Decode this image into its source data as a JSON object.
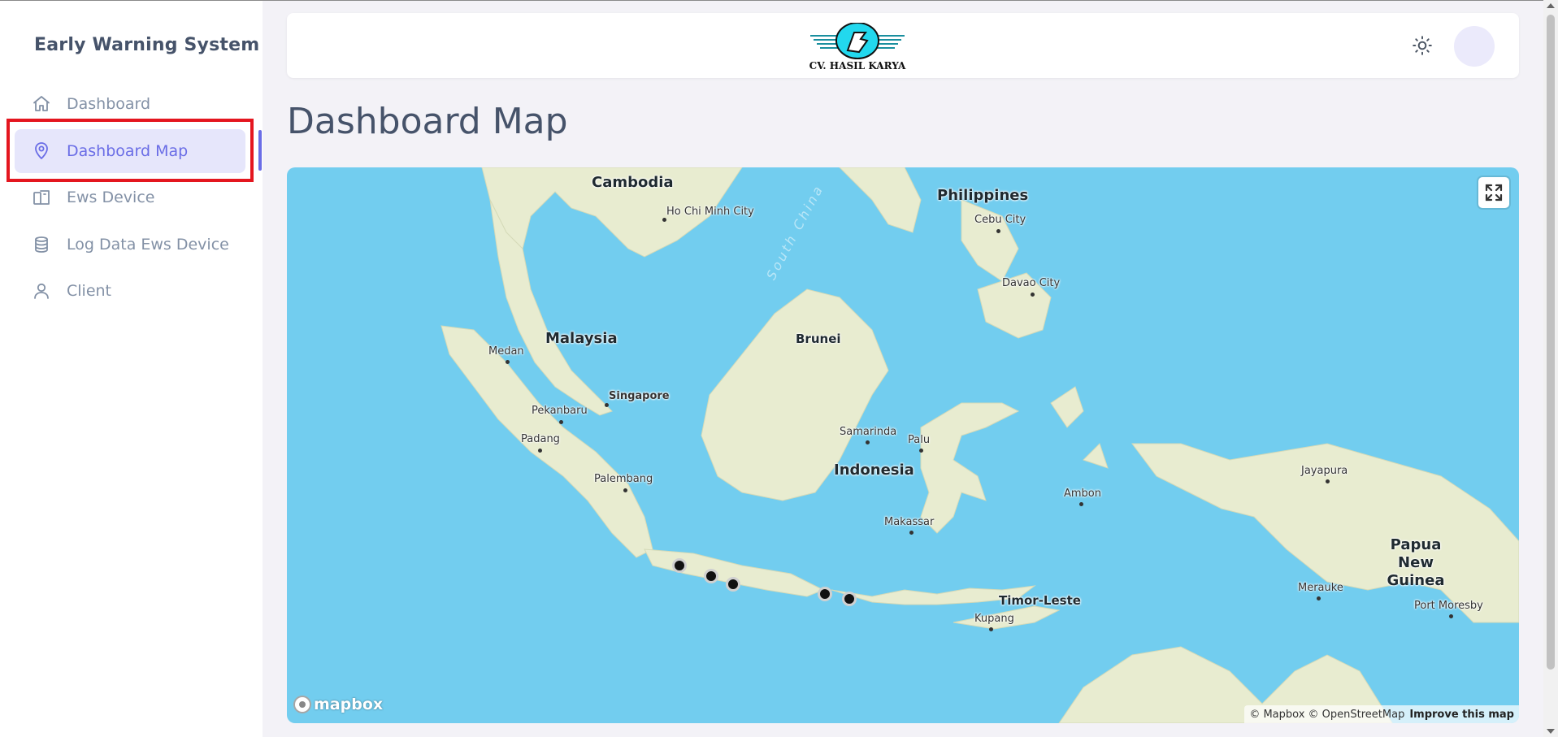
{
  "sidebar": {
    "brand": "Early Warning System",
    "items": [
      {
        "label": "Dashboard",
        "icon": "home-icon"
      },
      {
        "label": "Dashboard Map",
        "icon": "map-pin-icon",
        "active": true
      },
      {
        "label": "Ews Device",
        "icon": "device-icon"
      },
      {
        "label": "Log Data Ews Device",
        "icon": "database-icon"
      },
      {
        "label": "Client",
        "icon": "user-icon"
      }
    ]
  },
  "header": {
    "logo_text": "CV. HASIL KARYA",
    "theme_toggle_icon": "sun-icon"
  },
  "page": {
    "title": "Dashboard Map"
  },
  "map": {
    "labels": {
      "cambodia": "Cambodia",
      "ho_chi_minh": "Ho Chi Minh City",
      "south_china": "South China",
      "philippines": "Philippines",
      "cebu": "Cebu City",
      "davao": "Davao City",
      "malaysia": "Malaysia",
      "medan": "Medan",
      "brunei": "Brunei",
      "singapore": "Singapore",
      "pekanbaru": "Pekanbaru",
      "padang": "Padang",
      "samarinda": "Samarinda",
      "palu": "Palu",
      "indonesia": "Indonesia",
      "palembang": "Palembang",
      "jayapura": "Jayapura",
      "ambon": "Ambon",
      "makassar": "Makassar",
      "papua_new_guinea": "Papua New Guinea",
      "merauke": "Merauke",
      "port_moresby": "Port Moresby",
      "timor_leste": "Timor-Leste",
      "kupang": "Kupang"
    },
    "marker_count": 5,
    "logo": "mapbox",
    "attribution": "© Mapbox © OpenStreetMap",
    "improve": "Improve this map",
    "colors": {
      "water": "#72cdef",
      "land": "#e8ecd0",
      "marker": "#111111"
    }
  },
  "colors": {
    "accent": "#6a6de6",
    "highlight": "#e4161f",
    "background": "#f3f2f7"
  }
}
